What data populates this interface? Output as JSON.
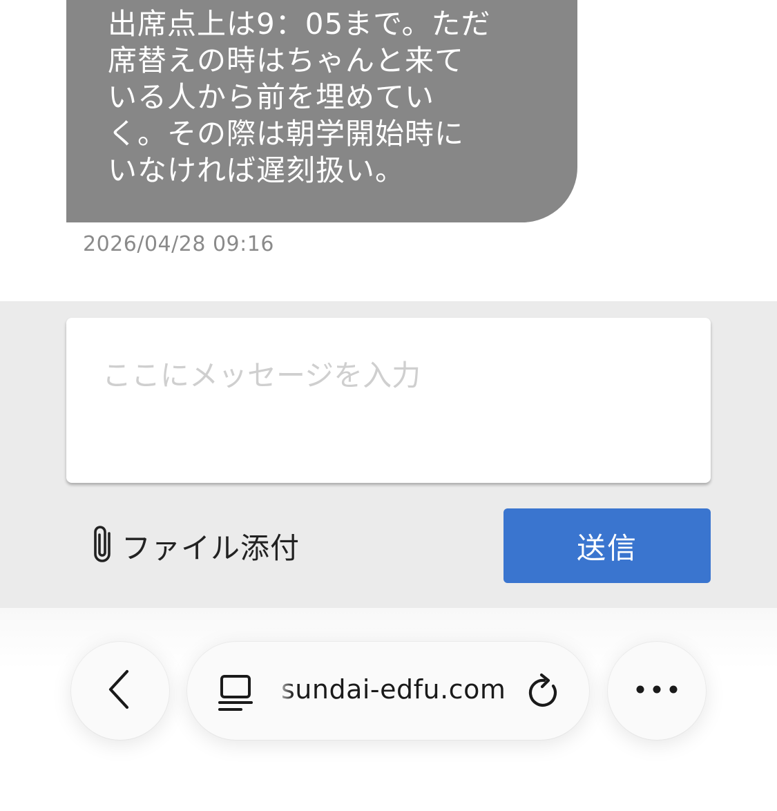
{
  "chat": {
    "message_text": "出席点上は9：05まで。ただ\n席替えの時はちゃんと来て\nいる人から前を埋めてい\nく。その際は朝学開始時に\nいなければ遅刻扱い。",
    "timestamp": "2026/04/28 09:16",
    "bubble_color": "#878787"
  },
  "composer": {
    "placeholder": "ここにメッセージを入力",
    "value": "",
    "attach_label": "ファイル添付",
    "attach_icon": "paperclip-icon",
    "send_label": "送信",
    "send_color": "#3a75cf"
  },
  "browser": {
    "url": "sundai-edfu.com",
    "back_icon": "chevron-left-icon",
    "tab_icon": "tab-overview-icon",
    "reload_icon": "reload-icon",
    "more_icon": "more-horizontal-icon"
  }
}
